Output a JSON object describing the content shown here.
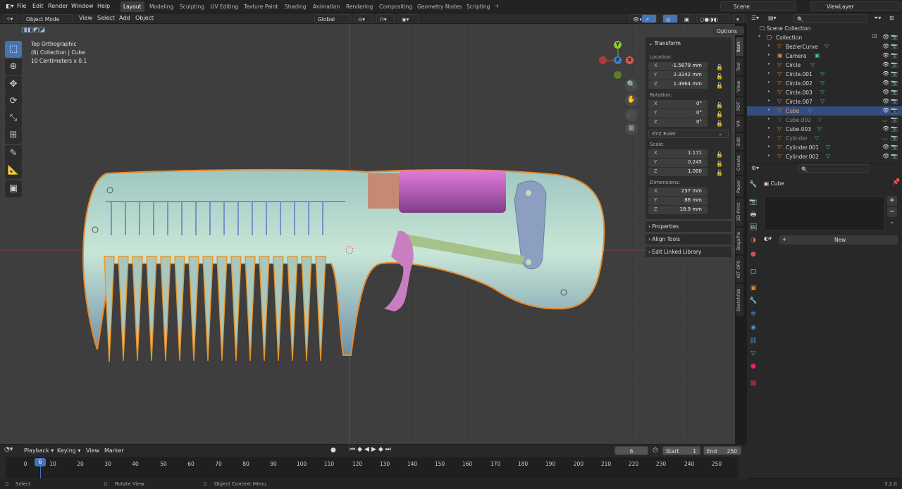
{
  "menu": {
    "items": [
      "File",
      "Edit",
      "Render",
      "Window",
      "Help"
    ],
    "workspaces": [
      "Layout",
      "Modeling",
      "Sculpting",
      "UV Editing",
      "Texture Paint",
      "Shading",
      "Animation",
      "Rendering",
      "Compositing",
      "Geometry Nodes",
      "Scripting"
    ],
    "active_workspace": "Layout",
    "add_tab": "+",
    "scene": "Scene",
    "view_layer": "ViewLayer"
  },
  "viewport_header": {
    "mode": "Object Mode",
    "menus": [
      "View",
      "Select",
      "Add",
      "Object"
    ],
    "orientation": "Global",
    "options": "Options"
  },
  "overlay_text": {
    "line1": "Top Orthographic",
    "line2": "(6) Collection | Cube",
    "line3": "10 Centimeters x 0.1"
  },
  "gizmo": {
    "x": "X",
    "y": "Y",
    "z": "Z"
  },
  "transform_panel": {
    "title": "Transform",
    "location_label": "Location:",
    "location": [
      {
        "axis": "X",
        "value": "-1.5679 mm"
      },
      {
        "axis": "Y",
        "value": "2.3242 mm"
      },
      {
        "axis": "Z",
        "value": "1.4964 mm"
      }
    ],
    "rotation_label": "Rotation:",
    "rotation": [
      {
        "axis": "X",
        "value": "0°"
      },
      {
        "axis": "Y",
        "value": "0°"
      },
      {
        "axis": "Z",
        "value": "0°"
      }
    ],
    "rotation_mode": "XYZ Euler",
    "scale_label": "Scale:",
    "scale": [
      {
        "axis": "X",
        "value": "1.171"
      },
      {
        "axis": "Y",
        "value": "0.245"
      },
      {
        "axis": "Z",
        "value": "1.000"
      }
    ],
    "dimensions_label": "Dimensions:",
    "dimensions": [
      {
        "axis": "X",
        "value": "237 mm"
      },
      {
        "axis": "Y",
        "value": "88 mm"
      },
      {
        "axis": "Z",
        "value": "18.9 mm"
      }
    ],
    "collapsed_panels": [
      "Properties",
      "Align Tools",
      "Edit Linked Library"
    ]
  },
  "side_tabs": [
    "Item",
    "Tool",
    "View",
    "PDT",
    "VR",
    "Edit",
    "Create",
    "Paper",
    "3D-Print",
    "BagaPie",
    "KIT OPS",
    "Sketchfab"
  ],
  "outliner": {
    "root": "Scene Collection",
    "collection": "Collection",
    "items": [
      {
        "name": "BezierCurve",
        "state": "normal"
      },
      {
        "name": "Camera",
        "state": "normal"
      },
      {
        "name": "Circle",
        "state": "normal"
      },
      {
        "name": "Circle.001",
        "state": "normal"
      },
      {
        "name": "Circle.002",
        "state": "normal"
      },
      {
        "name": "Circle.003",
        "state": "normal"
      },
      {
        "name": "Circle.007",
        "state": "normal"
      },
      {
        "name": "Cube",
        "state": "selected"
      },
      {
        "name": "Cube.002",
        "state": "hidden"
      },
      {
        "name": "Cube.003",
        "state": "normal"
      },
      {
        "name": "Cylinder",
        "state": "hidden"
      },
      {
        "name": "Cylinder.001",
        "state": "normal"
      },
      {
        "name": "Cylinder.002",
        "state": "normal"
      }
    ]
  },
  "properties": {
    "object_name": "Cube",
    "new_button": "New"
  },
  "timeline": {
    "menus": [
      "Playback",
      "Keying",
      "View",
      "Marker"
    ],
    "current_frame": "6",
    "start_label": "Start",
    "start": "1",
    "end_label": "End",
    "end": "250",
    "ticks": [
      "0",
      "10",
      "20",
      "30",
      "40",
      "50",
      "60",
      "70",
      "80",
      "90",
      "100",
      "110",
      "120",
      "130",
      "140",
      "150",
      "160",
      "170",
      "180",
      "190",
      "200",
      "210",
      "220",
      "230",
      "240",
      "250"
    ],
    "playhead": "6"
  },
  "status_bar": {
    "select": "Select",
    "rotate": "Rotate View",
    "context": "Object Context Menu",
    "version": "3.2.0"
  }
}
